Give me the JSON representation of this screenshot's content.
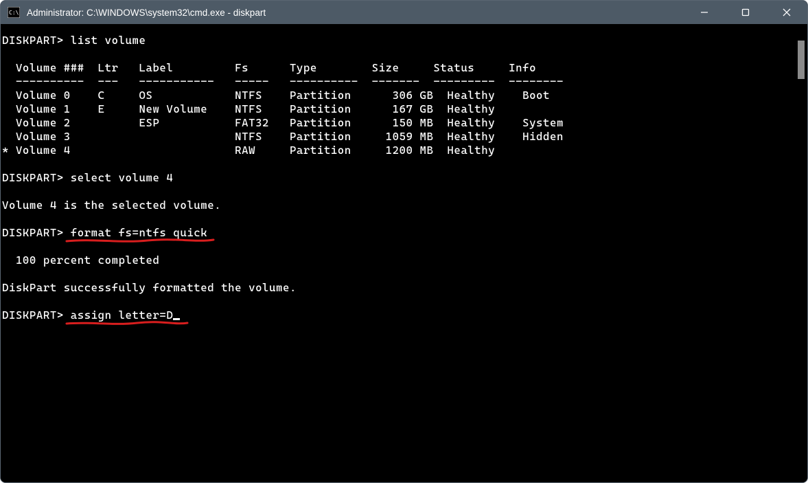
{
  "window": {
    "title": "Administrator: C:\\WINDOWS\\system32\\cmd.exe - diskpart"
  },
  "prompt": "DISKPART>",
  "cmd_list_volume": "list volume",
  "table": {
    "hdr": {
      "vol": "Volume ###",
      "ltr": "Ltr",
      "label": "Label",
      "fs": "Fs",
      "type": "Type",
      "size": "Size",
      "status": "Status",
      "info": "Info"
    },
    "sep": {
      "vol": "----------",
      "ltr": "---",
      "label": "-----------",
      "fs": "-----",
      "type": "----------",
      "size": "-------",
      "status": "---------",
      "info": "--------"
    },
    "rows": [
      {
        "sel": " ",
        "name": "Volume 0",
        "ltr": "C",
        "label": "OS",
        "fs": "NTFS",
        "type": "Partition",
        "size": "306 GB",
        "status": "Healthy",
        "info": "Boot"
      },
      {
        "sel": " ",
        "name": "Volume 1",
        "ltr": "E",
        "label": "New Volume",
        "fs": "NTFS",
        "type": "Partition",
        "size": "167 GB",
        "status": "Healthy",
        "info": ""
      },
      {
        "sel": " ",
        "name": "Volume 2",
        "ltr": "",
        "label": "ESP",
        "fs": "FAT32",
        "type": "Partition",
        "size": "150 MB",
        "status": "Healthy",
        "info": "System"
      },
      {
        "sel": " ",
        "name": "Volume 3",
        "ltr": "",
        "label": "",
        "fs": "NTFS",
        "type": "Partition",
        "size": "1059 MB",
        "status": "Healthy",
        "info": "Hidden"
      },
      {
        "sel": "*",
        "name": "Volume 4",
        "ltr": "",
        "label": "",
        "fs": "RAW",
        "type": "Partition",
        "size": "1200 MB",
        "status": "Healthy",
        "info": ""
      }
    ]
  },
  "cmd_select": "select volume 4",
  "msg_selected": "Volume 4 is the selected volume.",
  "cmd_format": "format fs=ntfs quick",
  "msg_progress": "  100 percent completed",
  "msg_format_done": "DiskPart successfully formatted the volume.",
  "cmd_assign": "assign letter=D",
  "annotation_color": "#d81e1e"
}
